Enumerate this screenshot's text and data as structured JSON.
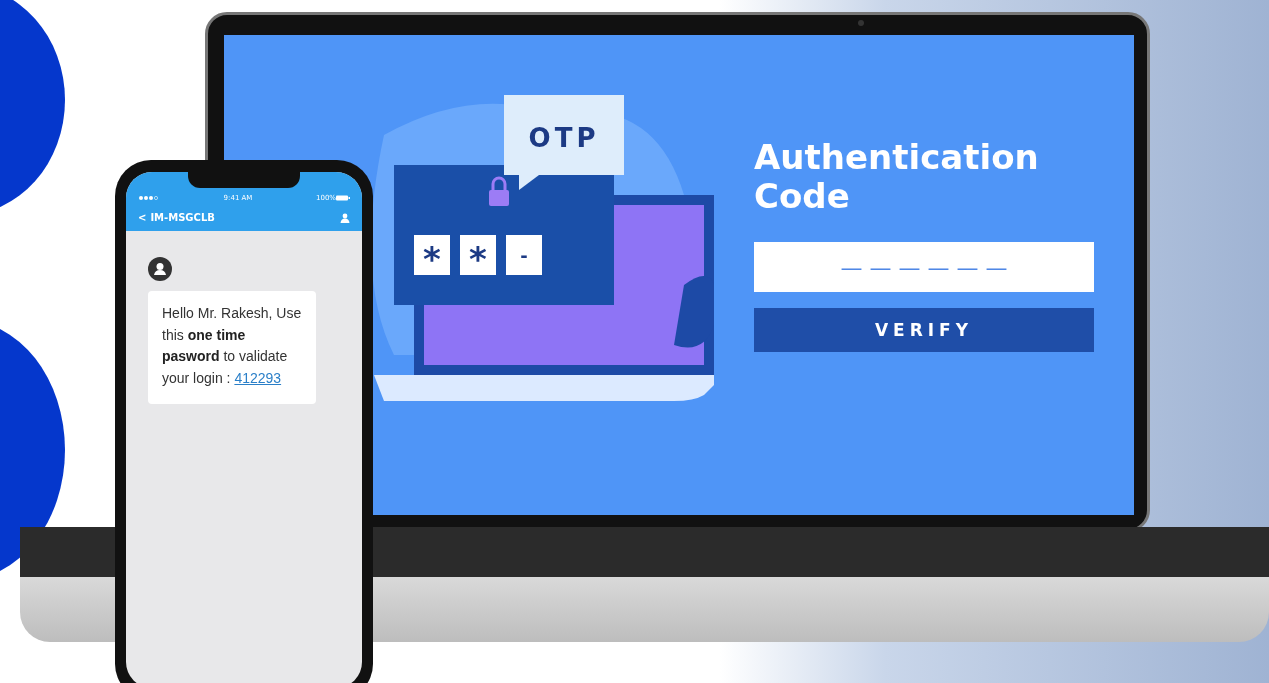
{
  "phone": {
    "status": {
      "time": "9:41 AM",
      "battery": "100%"
    },
    "header": {
      "back": "<",
      "sender": "IM-MSGCLB"
    },
    "message": {
      "text": "Hello Mr. Rakesh, Use this **one time pasword** to validate your login :",
      "code": "412293"
    }
  },
  "laptop": {
    "illustration": {
      "badge": "OTP",
      "slots": [
        "*",
        "*",
        "-"
      ]
    },
    "title": "Authentication Code",
    "code_field": {
      "placeholder": "— — — — — —"
    },
    "button": "VERIFY"
  }
}
